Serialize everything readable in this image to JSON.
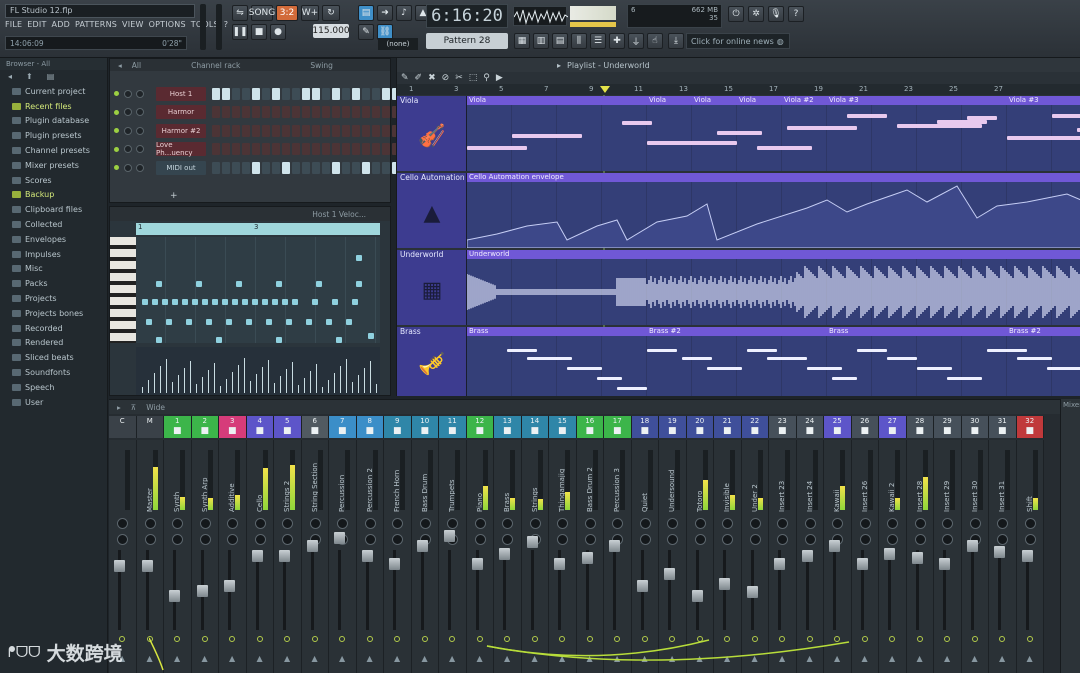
{
  "app": {
    "title": "FL Studio 12.flp",
    "hint_time": "14:06:09",
    "hint_value": "0'28\""
  },
  "menu": [
    "FILE",
    "EDIT",
    "ADD",
    "PATTERNS",
    "VIEW",
    "OPTIONS",
    "TOOLS",
    "?"
  ],
  "transport": {
    "tempo": "115.000",
    "clock": "6:16:20",
    "pattern": "Pattern 28",
    "snap": "(none)",
    "cpu_mb": "662 MB",
    "cpu_num1": "6",
    "cpu_num2": "35",
    "news": "Click for online news"
  },
  "browser": {
    "header": "Browser - All",
    "items": [
      {
        "label": "Current project",
        "hl": false
      },
      {
        "label": "Recent files",
        "hl": true
      },
      {
        "label": "Plugin database",
        "hl": false
      },
      {
        "label": "Plugin presets",
        "hl": false
      },
      {
        "label": "Channel presets",
        "hl": false
      },
      {
        "label": "Mixer presets",
        "hl": false
      },
      {
        "label": "Scores",
        "hl": false
      },
      {
        "label": "Backup",
        "hl": true
      },
      {
        "label": "Clipboard files",
        "hl": false
      },
      {
        "label": "Collected",
        "hl": false
      },
      {
        "label": "Envelopes",
        "hl": false
      },
      {
        "label": "Impulses",
        "hl": false
      },
      {
        "label": "Misc",
        "hl": false
      },
      {
        "label": "Packs",
        "hl": false
      },
      {
        "label": "Projects",
        "hl": false
      },
      {
        "label": "Projects bones",
        "hl": false
      },
      {
        "label": "Recorded",
        "hl": false
      },
      {
        "label": "Rendered",
        "hl": false
      },
      {
        "label": "Sliced beats",
        "hl": false
      },
      {
        "label": "Soundfonts",
        "hl": false
      },
      {
        "label": "Speech",
        "hl": false
      },
      {
        "label": "User",
        "hl": false
      }
    ]
  },
  "channel_rack": {
    "title": "Channel rack",
    "filter": "All",
    "swing": "Swing",
    "channels": [
      {
        "name": "Host 1",
        "steps": [
          1,
          1,
          0,
          0,
          1,
          0,
          1,
          0,
          0,
          1,
          1,
          0,
          1,
          0,
          1,
          0,
          0,
          1,
          1,
          0
        ],
        "midi": true
      },
      {
        "name": "Harmor",
        "steps": [
          0,
          0,
          0,
          0,
          0,
          0,
          0,
          0,
          0,
          0,
          0,
          0,
          0,
          0,
          0,
          0,
          0,
          0,
          0,
          0
        ],
        "midi": false
      },
      {
        "name": "Harmor #2",
        "steps": [
          0,
          0,
          0,
          0,
          0,
          0,
          0,
          0,
          0,
          0,
          0,
          0,
          0,
          0,
          0,
          0,
          0,
          0,
          0,
          0
        ],
        "midi": false
      },
      {
        "name": "Love Ph...uency",
        "steps": [
          0,
          0,
          0,
          0,
          0,
          0,
          0,
          0,
          0,
          0,
          0,
          0,
          0,
          0,
          0,
          0,
          0,
          0,
          0,
          0
        ],
        "midi": false
      },
      {
        "name": "MIDI out",
        "steps": [
          0,
          0,
          0,
          0,
          1,
          0,
          0,
          1,
          0,
          0,
          0,
          0,
          1,
          0,
          0,
          1,
          0,
          0,
          1,
          0
        ],
        "midi": true
      }
    ]
  },
  "piano_roll": {
    "title": "Host 1 Veloc...",
    "bar1": "1",
    "bar2": "3"
  },
  "playlist": {
    "title": "Playlist - Underworld",
    "bars": [
      "1",
      "3",
      "5",
      "7",
      "9",
      "11",
      "13",
      "15",
      "17",
      "19",
      "21",
      "23",
      "25",
      "27"
    ],
    "tracks": [
      {
        "name": "Viola",
        "clips": [
          "Viola",
          "Viola",
          "Viola",
          "Viola",
          "Viola #2",
          "Viola #3",
          "Viola #3"
        ],
        "icon": "violin-icon"
      },
      {
        "name": "Cello Automation",
        "clips": [
          "Cello Automation envelope"
        ],
        "icon": "hat-icon"
      },
      {
        "name": "Underworld",
        "clips": [
          "Underworld"
        ],
        "icon": "synth-icon"
      },
      {
        "name": "Brass",
        "clips": [
          "Brass",
          "Brass #2",
          "Brass",
          "Brass #2"
        ],
        "icon": "trumpet-icon"
      }
    ]
  },
  "mixer": {
    "title": "Wide",
    "right_label": "Mixer",
    "strips": [
      {
        "num": "C",
        "name": "",
        "color": "#3a4148",
        "level": 0
      },
      {
        "num": "M",
        "name": "Master",
        "color": "#3a4148",
        "level": 0.72
      },
      {
        "num": "1",
        "name": "Synth",
        "color": "#3cb54a",
        "level": 0.22
      },
      {
        "num": "2",
        "name": "Synth Arp",
        "color": "#3cb54a",
        "level": 0.2
      },
      {
        "num": "3",
        "name": "Additive",
        "color": "#d63c7a",
        "level": 0.25
      },
      {
        "num": "4",
        "name": "Cello",
        "color": "#5d55c9",
        "level": 0.7
      },
      {
        "num": "5",
        "name": "Strings 2",
        "color": "#5d55c9",
        "level": 0.75
      },
      {
        "num": "6",
        "name": "String Section",
        "color": "#515a61",
        "level": 0
      },
      {
        "num": "7",
        "name": "Percussion",
        "color": "#3b8ec8",
        "level": 0
      },
      {
        "num": "8",
        "name": "Percussion 2",
        "color": "#3b8ec8",
        "level": 0
      },
      {
        "num": "9",
        "name": "French Horn",
        "color": "#2f86a8",
        "level": 0
      },
      {
        "num": "10",
        "name": "Bass Drum",
        "color": "#2f86a8",
        "level": 0
      },
      {
        "num": "11",
        "name": "Trumpets",
        "color": "#2f86a8",
        "level": 0
      },
      {
        "num": "12",
        "name": "Piano",
        "color": "#3cb54a",
        "level": 0.4
      },
      {
        "num": "13",
        "name": "Brass",
        "color": "#2f86a8",
        "level": 0.2
      },
      {
        "num": "14",
        "name": "Strings",
        "color": "#2f86a8",
        "level": 0.18
      },
      {
        "num": "15",
        "name": "Thingamajig",
        "color": "#2f86a8",
        "level": 0.3
      },
      {
        "num": "16",
        "name": "Bass Drum 2",
        "color": "#3cb54a",
        "level": 0
      },
      {
        "num": "17",
        "name": "Percussion 3",
        "color": "#3cb54a",
        "level": 0
      },
      {
        "num": "18",
        "name": "Quiet",
        "color": "#3f4f9a",
        "level": 0
      },
      {
        "num": "19",
        "name": "Undersound",
        "color": "#3f4f9a",
        "level": 0
      },
      {
        "num": "20",
        "name": "Totoro",
        "color": "#3f4f9a",
        "level": 0.5
      },
      {
        "num": "21",
        "name": "Invisible",
        "color": "#3f4f9a",
        "level": 0.25
      },
      {
        "num": "22",
        "name": "Under 2",
        "color": "#3f4f9a",
        "level": 0.2
      },
      {
        "num": "23",
        "name": "Insert 23",
        "color": "#46505a",
        "level": 0
      },
      {
        "num": "24",
        "name": "Insert 24",
        "color": "#46505a",
        "level": 0
      },
      {
        "num": "25",
        "name": "Kawaii",
        "color": "#5d55c9",
        "level": 0.4
      },
      {
        "num": "26",
        "name": "Insert 26",
        "color": "#46505a",
        "level": 0
      },
      {
        "num": "27",
        "name": "Kawaii 2",
        "color": "#5d55c9",
        "level": 0.2
      },
      {
        "num": "28",
        "name": "Insert 28",
        "color": "#46505a",
        "level": 0.55
      },
      {
        "num": "29",
        "name": "Insert 29",
        "color": "#46505a",
        "level": 0
      },
      {
        "num": "30",
        "name": "Insert 30",
        "color": "#46505a",
        "level": 0
      },
      {
        "num": "31",
        "name": "Insert 31",
        "color": "#46505a",
        "level": 0
      },
      {
        "num": "32",
        "name": "Shift",
        "color": "#c0393b",
        "level": 0.2
      }
    ]
  },
  "watermark": {
    "text": "大数跨境"
  }
}
